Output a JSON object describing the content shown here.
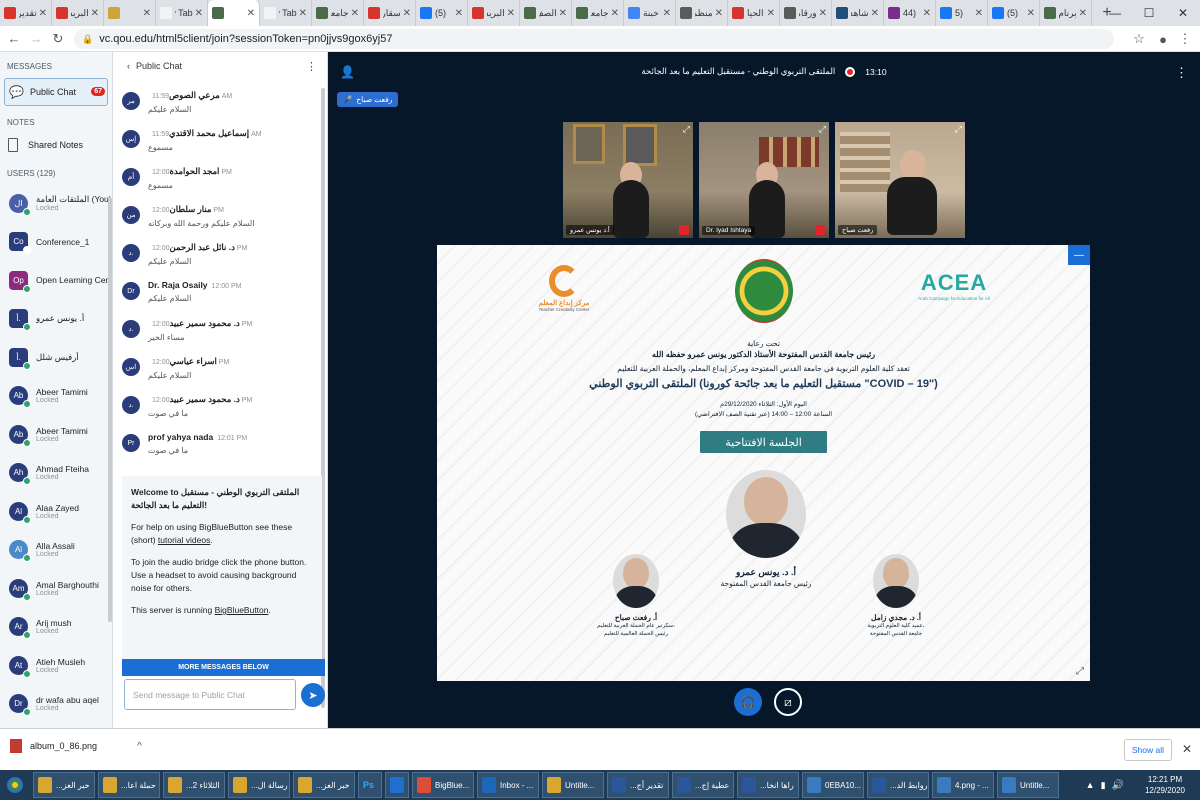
{
  "browser": {
    "tabs": [
      {
        "label": "تقدير",
        "favicon_color": "#d8342b"
      },
      {
        "label": "البريد",
        "favicon_color": "#d8342b"
      },
      {
        "label": "",
        "favicon_color": "#cfa53a"
      },
      {
        "label": "New Tab",
        "favicon_color": "#f1f3f4"
      },
      {
        "label": "",
        "favicon_color": "#4a6b4a",
        "active": true
      },
      {
        "label": "New Tab",
        "favicon_color": "#f1f3f4"
      },
      {
        "label": "جامعة",
        "favicon_color": "#4a6b4a"
      },
      {
        "label": "سقار",
        "favicon_color": "#d8342b"
      },
      {
        "label": "(5)",
        "favicon_color": "#1877f2"
      },
      {
        "label": "البريد",
        "favicon_color": "#d8342b"
      },
      {
        "label": "الصف",
        "favicon_color": "#4a6b4a"
      },
      {
        "label": "جامعة",
        "favicon_color": "#4a6b4a"
      },
      {
        "label": "خبنة",
        "favicon_color": "#4285f4"
      },
      {
        "label": "منظمة",
        "favicon_color": "#5a5a5a"
      },
      {
        "label": "الحيا",
        "favicon_color": "#d8342b"
      },
      {
        "label": "ورقاة",
        "favicon_color": "#5a5a5a"
      },
      {
        "label": "شاهد",
        "favicon_color": "#1f4e79"
      },
      {
        "label": "(44",
        "favicon_color": "#7b2d8e"
      },
      {
        "label": "(5",
        "favicon_color": "#1877f2"
      },
      {
        "label": "(5)",
        "favicon_color": "#1877f2"
      },
      {
        "label": "برنام",
        "favicon_color": "#4a6b4a"
      }
    ],
    "new_tab_label": "+",
    "url": "vc.qou.edu/html5client/join?sessionToken=pn0jjvs9gox6yj57"
  },
  "sidebar": {
    "messages_heading": "MESSAGES",
    "public_chat_label": "Public Chat",
    "public_chat_badge": "67",
    "notes_heading": "NOTES",
    "shared_notes_label": "Shared Notes",
    "users_heading": "USERS (129)",
    "users": [
      {
        "initials": "ال",
        "name": "الملتقات العامة (You)",
        "status": "Locked",
        "color": "#4a5fa8",
        "round": true
      },
      {
        "initials": "Co",
        "name": "Conference_1",
        "status": "",
        "color": "#2b3c7a",
        "round": false
      },
      {
        "initials": "Op",
        "name": "Open Learning Cent...",
        "status": "",
        "color": "#8c2a7e",
        "round": false
      },
      {
        "initials": "أ.",
        "name": "أ. يونس عمرو",
        "status": "",
        "color": "#2b3c7a",
        "round": false
      },
      {
        "initials": "أ.",
        "name": "أرفيس شلل",
        "status": "",
        "color": "#2b3c7a",
        "round": false
      },
      {
        "initials": "Ab",
        "name": "Abeer Tamimi",
        "status": "Locked",
        "color": "#2b3c7a",
        "round": true
      },
      {
        "initials": "Ab",
        "name": "Abeer Tamimi",
        "status": "Locked",
        "color": "#2b3c7a",
        "round": true
      },
      {
        "initials": "Ah",
        "name": "Ahmad Fteiha",
        "status": "Locked",
        "color": "#2b3c7a",
        "round": true
      },
      {
        "initials": "Al",
        "name": "Alaa Zayed",
        "status": "Locked",
        "color": "#2b3c7a",
        "round": true
      },
      {
        "initials": "Al",
        "name": "Alla Assali",
        "status": "Locked",
        "color": "#4a8ac8",
        "round": true
      },
      {
        "initials": "Am",
        "name": "Amal Barghouthi",
        "status": "Locked",
        "color": "#2b3c7a",
        "round": true
      },
      {
        "initials": "Ar",
        "name": "Arij mush",
        "status": "Locked",
        "color": "#2b3c7a",
        "round": true
      },
      {
        "initials": "At",
        "name": "Atieh Musleh",
        "status": "Locked",
        "color": "#2b3c7a",
        "round": true
      },
      {
        "initials": "Dr",
        "name": "dr wafa abu aqel",
        "status": "Locked",
        "color": "#2b3c7a",
        "round": true
      }
    ]
  },
  "chat": {
    "title": "Public Chat",
    "messages": [
      {
        "initials": "مر",
        "name": "مرعي الصوص",
        "time": "11:59 AM",
        "text": "السلام عليكم"
      },
      {
        "initials": "إس",
        "name": "إسماعيل محمد الاقتدي",
        "time": "11:59 AM",
        "text": "مسموع"
      },
      {
        "initials": "أم",
        "name": "امجد الحوامدة",
        "time": "12:00 PM",
        "text": "مسموع"
      },
      {
        "initials": "من",
        "name": "منار سلطان",
        "time": "12:00 PM",
        "text": "السلام عليكم ورحمة الله وبركاته"
      },
      {
        "initials": "د.",
        "name": "د. نائل عبد الرحمن",
        "time": "12:00 PM",
        "text": "السلام عليكم"
      },
      {
        "initials": "Dr",
        "name": "Dr. Raja Osaily",
        "time": "12:00 PM",
        "text": "السلام عليكم"
      },
      {
        "initials": "د.",
        "name": "د. محمود سمير عبيد",
        "time": "12:00 PM",
        "text": "مساء الخير"
      },
      {
        "initials": "اس",
        "name": "اسراء عياسي",
        "time": "12:00 PM",
        "text": "السلام عليكم"
      },
      {
        "initials": "د.",
        "name": "د. محمود سمير عبيد",
        "time": "12:00 PM",
        "text": "ما في صوت"
      },
      {
        "initials": "Pr",
        "name": "prof yahya nada",
        "time": "12:01 PM",
        "text": "ما في صوت"
      }
    ],
    "welcome": {
      "line1": "Welcome to الملتقى التربوي الوطني - مستقبل التعليم ما بعد الجائحة!",
      "line2_prefix": "For help on using BigBlueButton see these (short) ",
      "line2_link": "tutorial videos",
      "line2_suffix": ".",
      "line3": "To join the audio bridge click the phone button. Use a headset to avoid causing background noise for others.",
      "line4_prefix": "This server is running ",
      "line4_link": "BigBlueButton",
      "line4_suffix": "."
    },
    "more_messages": "MORE MESSAGES BELOW",
    "input_placeholder": "Send message to Public Chat"
  },
  "meeting": {
    "title": "الملتقى التربوي الوطني - مستقبل التعليم ما بعد الجائحة",
    "time": "13:10",
    "talking": "رفعت صباح",
    "cameras": [
      {
        "label": "أ.د يونس عمرو"
      },
      {
        "label": "Dr. Iyad Ishtaya"
      },
      {
        "label": "رفعت صباح"
      }
    ]
  },
  "slide": {
    "logo_left": "مركز إبداع المعلم",
    "logo_left_en": "Teacher Creativity Center",
    "logo_right": "ACEA",
    "logo_right_sub": "Arab Campaign for Education for All",
    "line_patronage": "تحت رعاية",
    "line_president": "رئيس جامعة القدس المفتوحة الأستاذ الدكتور يونس عمرو حفظه الله",
    "line_organizers": "تعقد كلية العلوم التربوية في جامعة القدس المفتوحة ومركز إبداع المعلم، والحملة العربية للتعليم",
    "line_title": "الملتقى التربوي الوطني (مستقبل التعليم ما بعد جائحة كورونا \"COVID – 19\")",
    "line_date": "اليوم الأول: الثلاثاء 29/12/2020م",
    "line_time": "الساعة 12:00 – 14:00 (عبر تقنية الصف الافتراضي)",
    "opening_label": "الجلسة الافتتاحية",
    "speaker_main_name": "أ. د. يونس عمرو",
    "speaker_main_title": "رئيس جامعة القدس المفتوحة",
    "speaker_left_name": "أ. رفعت صباح",
    "speaker_left_title1": "سكرتير عام الحملة العربية للتعليم،",
    "speaker_left_title2": "رئيس الحملة العالمية للتعليم",
    "speaker_right_name": "أ. د. مجدي زامل",
    "speaker_right_title1": "عميد كلية العلوم التربوية،",
    "speaker_right_title2": "جامعة القدس المفتوحة"
  },
  "downloads": {
    "file_name": "album_0_86.png",
    "show_all": "Show all"
  },
  "taskbar": {
    "items": [
      {
        "label": "...خبر الغز",
        "color": "#d9a62f"
      },
      {
        "label": "...حملة اعا",
        "color": "#d9a62f"
      },
      {
        "label": "...الثلاثاء 2",
        "color": "#d9a62f"
      },
      {
        "label": "...رسالة ال",
        "color": "#d9a62f"
      },
      {
        "label": "...خبر الغز",
        "color": "#d9a62f"
      },
      {
        "label": "",
        "color": "#2b63b8"
      },
      {
        "label": "",
        "color": "#1e6fd0"
      },
      {
        "label": "BigBlue...",
        "color": "#dd4b39"
      },
      {
        "label": "Inbox - ...",
        "color": "#1c67b8"
      },
      {
        "label": "Untitle...",
        "color": "#d9a62f"
      },
      {
        "label": "...تقدير أج",
        "color": "#2b579a"
      },
      {
        "label": "...عطية إج",
        "color": "#2b579a"
      },
      {
        "label": "...راها انخا",
        "color": "#2b579a"
      },
      {
        "label": "0EBA10...",
        "color": "#3a7bbf"
      },
      {
        "label": "...روابط الد",
        "color": "#2b579a"
      },
      {
        "label": "4.png - ...",
        "color": "#3a7bbf"
      },
      {
        "label": "Untitle...",
        "color": "#3a7bbf"
      }
    ],
    "clock_time": "12:21 PM",
    "clock_date": "12/29/2020",
    "ps_label": "Ps"
  }
}
